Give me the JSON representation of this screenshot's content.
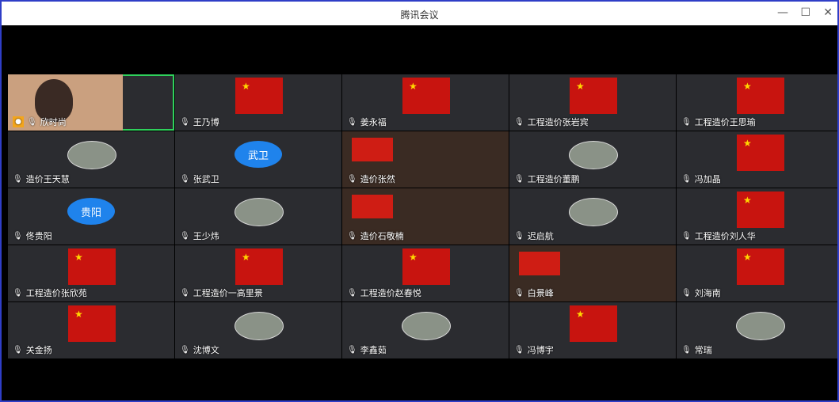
{
  "window": {
    "title": "腾讯会议",
    "min": "—",
    "max": "☐",
    "close": "✕"
  },
  "participants": [
    {
      "name": "欣时尚",
      "thumb": "portrait",
      "active": true,
      "host": true
    },
    {
      "name": "王乃博",
      "thumb": "flag"
    },
    {
      "name": "姜永福",
      "thumb": "flag"
    },
    {
      "name": "工程造价张岩宾",
      "thumb": "flag"
    },
    {
      "name": "工程造价王思瑜",
      "thumb": "flag"
    },
    {
      "name": "造价王天慧",
      "thumb": "photo"
    },
    {
      "name": "张武卫",
      "thumb": "avatar",
      "avatar": "武卫"
    },
    {
      "name": "造价张然",
      "thumb": "screen"
    },
    {
      "name": "工程造价董鹏",
      "thumb": "photo"
    },
    {
      "name": "冯加晶",
      "thumb": "flag"
    },
    {
      "name": "佟贵阳",
      "thumb": "avatar",
      "avatar": "贵阳"
    },
    {
      "name": "王少炜",
      "thumb": "photo"
    },
    {
      "name": "造价石敬楠",
      "thumb": "screen"
    },
    {
      "name": "迟启航",
      "thumb": "photo"
    },
    {
      "name": "工程造价刘人华",
      "thumb": "flag"
    },
    {
      "name": "工程造价张欣苑",
      "thumb": "flag"
    },
    {
      "name": "工程造价一高里景",
      "thumb": "flag"
    },
    {
      "name": "工程造价赵春悦",
      "thumb": "flag"
    },
    {
      "name": "白景峰",
      "thumb": "screen"
    },
    {
      "name": "刘海南",
      "thumb": "flag"
    },
    {
      "name": "关金扬",
      "thumb": "flag"
    },
    {
      "name": "沈博文",
      "thumb": "photo"
    },
    {
      "name": "李鑫茹",
      "thumb": "photo"
    },
    {
      "name": "冯博宇",
      "thumb": "flag"
    },
    {
      "name": "常瑞",
      "thumb": "photo"
    }
  ]
}
